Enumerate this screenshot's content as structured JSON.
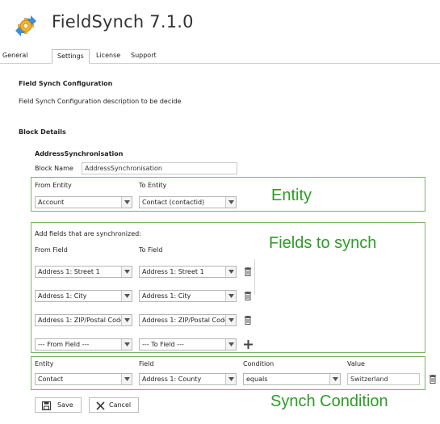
{
  "header": {
    "title": "FieldSynch 7.1.0",
    "logo_icon": "gear-sync-icon"
  },
  "tabs": [
    {
      "label": "General",
      "active": false
    },
    {
      "label": "Settings",
      "active": true
    },
    {
      "label": "License",
      "active": false
    },
    {
      "label": "Support",
      "active": false
    }
  ],
  "config": {
    "heading": "Field Synch Configuration",
    "description": "Field Synch Configuration description to be decide"
  },
  "block": {
    "heading": "Block Details",
    "name_heading": "AddressSynchronisation",
    "name_label": "Block Name",
    "name_value": "AddressSynchronisation"
  },
  "entity": {
    "from_label": "From Entity",
    "to_label": "To Entity",
    "from_value": "Account",
    "to_value": "Contact (contactid)",
    "annotation": "Entity"
  },
  "fields": {
    "intro": "Add fields that are synchronized:",
    "from_label": "From Field",
    "to_label": "To Field",
    "annotation": "Fields to synch",
    "rows": [
      {
        "from": "Address 1: Street 1",
        "to": "Address 1: Street 1"
      },
      {
        "from": "Address 1: City",
        "to": "Address 1: City"
      },
      {
        "from": "Address 1: ZIP/Postal Code",
        "to": "Address 1: ZIP/Postal Code"
      }
    ],
    "new_row": {
      "from": "--- From Field ---",
      "to": "--- To Field ---"
    }
  },
  "condition": {
    "entity_label": "Entity",
    "field_label": "Field",
    "condition_label": "Condition",
    "value_label": "Value",
    "entity_value": "Contact",
    "field_value": "Address 1: County",
    "condition_value": "equals",
    "value_value": "Switzerland",
    "annotation": "Synch Condition"
  },
  "buttons": {
    "save": "Save",
    "cancel": "Cancel"
  },
  "colors": {
    "annotation_green": "#2f9a28",
    "frame_green": "#7db36a"
  }
}
